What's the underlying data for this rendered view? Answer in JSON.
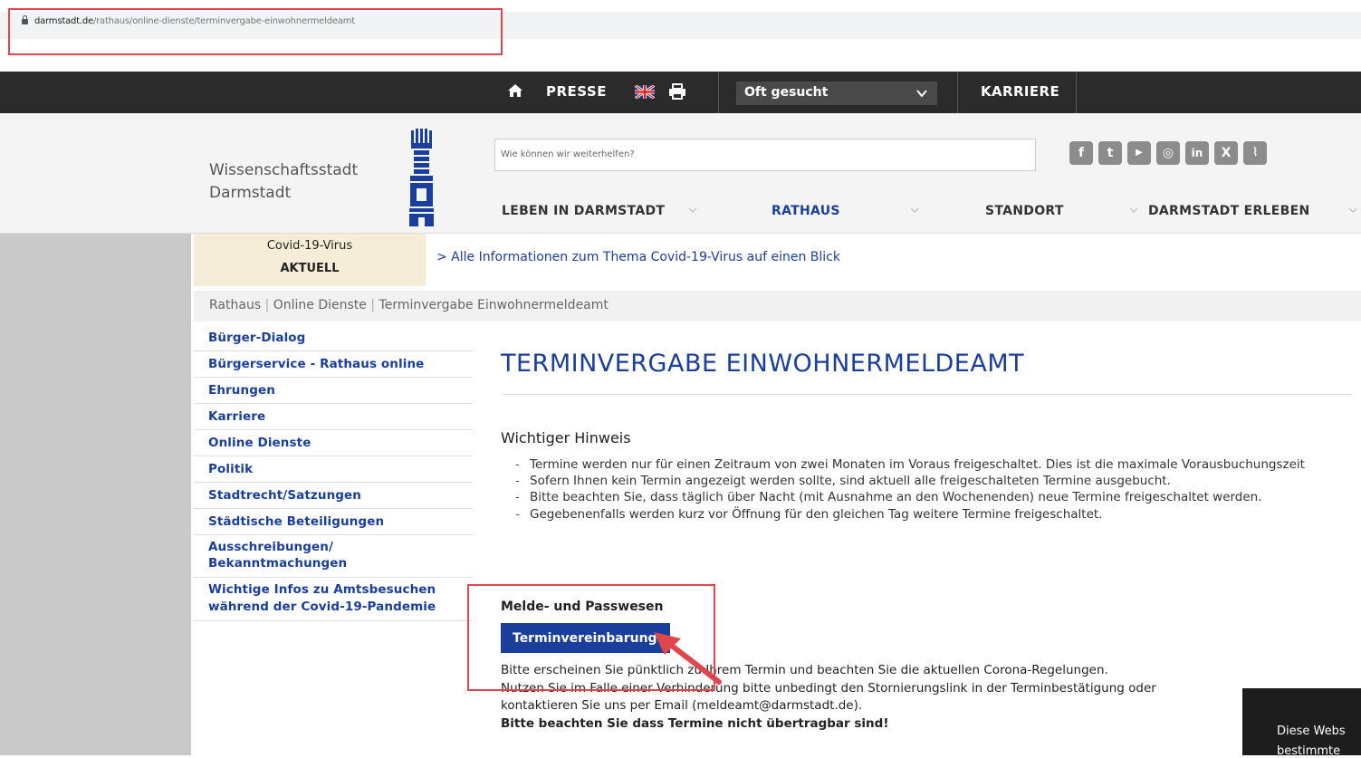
{
  "browser": {
    "url_host": "darmstadt.de",
    "url_path": "/rathaus/online-dienste/terminvergabe-einwohnermeldeamt"
  },
  "topnav": {
    "presse": "PRESSE",
    "oft_gesucht": "Oft gesucht",
    "karriere": "KARRIERE"
  },
  "header": {
    "brand_line1": "Wissenschaftsstadt",
    "brand_line2": "Darmstadt",
    "search_placeholder": "Wie können wir weiterhelfen?",
    "social_icons": [
      "facebook-icon",
      "twitter-icon",
      "youtube-icon",
      "instagram-icon",
      "linkedin-icon",
      "xing-icon",
      "rss-icon"
    ],
    "nav": [
      "LEBEN IN DARMSTADT",
      "RATHAUS",
      "STANDORT",
      "DARMSTADT ERLEBEN"
    ]
  },
  "covid": {
    "line1": "Covid-19-Virus",
    "line2": "AKTUELL",
    "link": "> Alle Informationen zum Thema Covid-19-Virus auf einen Blick"
  },
  "breadcrumb": {
    "items": [
      "Rathaus",
      "Online Dienste",
      "Terminvergabe Einwohnermeldeamt"
    ],
    "sep": "|"
  },
  "sidebar": {
    "items": [
      "Bürger-Dialog",
      "Bürgerservice - Rathaus online",
      "Ehrungen",
      "Karriere",
      "Online Dienste",
      "Politik",
      "Stadtrecht/Satzungen",
      "Städtische Beteiligungen",
      "Ausschreibungen/ Bekanntmachungen",
      "Wichtige Infos zu Amtsbesuchen während der Covid-19-Pandemie"
    ]
  },
  "main": {
    "title": "TERMINVERGABE EINWOHNERMELDEAMT",
    "hinweis_heading": "Wichtiger Hinweis",
    "bullets": [
      "Termine werden nur für einen Zeitraum von zwei Monaten im Voraus freigeschaltet. Dies ist die maximale Vorausbuchungszeit",
      "Sofern Ihnen kein Termin angezeigt werden sollte, sind aktuell alle freigeschalteten Termine ausgebucht.",
      "Bitte beachten Sie, dass täglich über Nacht (mit Ausnahme an den Wochenenden) neue Termine freigeschaltet werden.",
      "Gegebenenfalls werden kurz vor Öffnung für den gleichen Tag weitere Termine freigeschaltet."
    ],
    "melde_heading": "Melde- und Passwesen",
    "termin_button": "Terminvereinbarung",
    "body_line1": "Bitte erscheinen Sie pünktlich zu Ihrem Termin und beachten Sie die aktuellen Corona-Regelungen.",
    "body_line2": "Nutzen Sie im Falle einer Verhinderung bitte unbedingt den Stornierungslink in der Terminbestätigung oder",
    "body_line3": "kontaktieren Sie uns per Email (meldeamt@darmstadt.de).",
    "body_line4": "Bitte beachten Sie dass Termine nicht übertragbar sind!"
  },
  "cookie": {
    "line1": "Diese Webs",
    "line2": "bestimmte"
  },
  "colors": {
    "accent": "#1a3e9b",
    "highlight": "#e0474c",
    "nav_bg": "#2b2b2b"
  }
}
